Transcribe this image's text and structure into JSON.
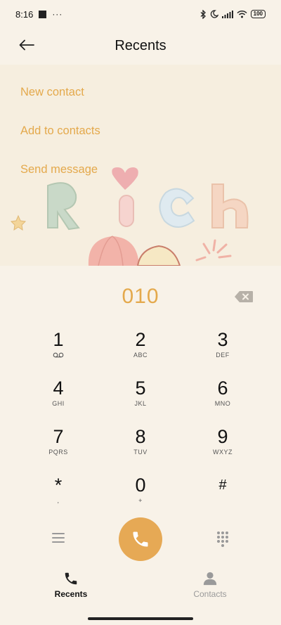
{
  "status_bar": {
    "time": "8:16",
    "notification_dots": "···",
    "battery": "100"
  },
  "header": {
    "title": "Recents"
  },
  "options": {
    "new_contact": "New contact",
    "add_to_contacts": "Add to contacts",
    "send_message": "Send message"
  },
  "dialer": {
    "number": "010",
    "keys": [
      {
        "digit": "1",
        "letters": "",
        "icon": "voicemail-icon"
      },
      {
        "digit": "2",
        "letters": "ABC"
      },
      {
        "digit": "3",
        "letters": "DEF"
      },
      {
        "digit": "4",
        "letters": "GHI"
      },
      {
        "digit": "5",
        "letters": "JKL"
      },
      {
        "digit": "6",
        "letters": "MNO"
      },
      {
        "digit": "7",
        "letters": "PQRS"
      },
      {
        "digit": "8",
        "letters": "TUV"
      },
      {
        "digit": "9",
        "letters": "WXYZ"
      },
      {
        "digit": "*",
        "letters": ","
      },
      {
        "digit": "0",
        "letters": "+"
      },
      {
        "digit": "#",
        "letters": ""
      }
    ]
  },
  "bottom_nav": {
    "recents": "Recents",
    "contacts": "Contacts"
  },
  "colors": {
    "accent": "#e4a94c",
    "call_button": "#e6a955",
    "background": "#f8f2e8"
  }
}
